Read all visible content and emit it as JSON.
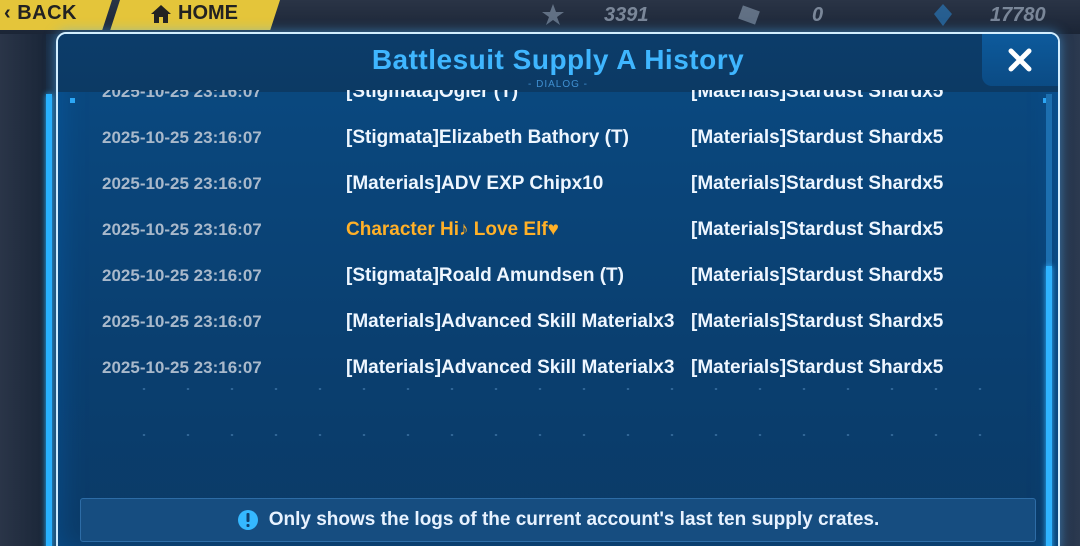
{
  "topbar": {
    "back_label": "BACK",
    "home_label": "HOME",
    "resource_1": "3391",
    "resource_2": "0",
    "resource_3": "17780"
  },
  "dialog": {
    "title": "Battlesuit Supply A History",
    "subtitle": "- DIALOG -",
    "close_icon": "close-icon"
  },
  "rows": [
    {
      "date": "2025-10-25 23:16:07",
      "item": "[Stigmata]Ogier (T)",
      "reward": "[Materials]Stardust Shardx5"
    },
    {
      "date": "2025-10-25 23:16:07",
      "item": "[Stigmata]Elizabeth Bathory (T)",
      "reward": "[Materials]Stardust Shardx5"
    },
    {
      "date": "2025-10-25 23:16:07",
      "item": "[Materials]ADV EXP Chipx10",
      "reward": "[Materials]Stardust Shardx5"
    },
    {
      "date": "2025-10-25 23:16:07",
      "item": "Character Hi♪ Love Elf♥",
      "reward": "[Materials]Stardust Shardx5",
      "highlight": true
    },
    {
      "date": "2025-10-25 23:16:07",
      "item": "[Stigmata]Roald Amundsen (T)",
      "reward": "[Materials]Stardust Shardx5"
    },
    {
      "date": "2025-10-25 23:16:07",
      "item": "[Materials]Advanced Skill Materialx3",
      "reward": "[Materials]Stardust Shardx5"
    },
    {
      "date": "2025-10-25 23:16:07",
      "item": "[Materials]Advanced Skill Materialx3",
      "reward": "[Materials]Stardust Shardx5"
    }
  ],
  "notice": {
    "icon": "info-icon",
    "text": "Only shows the logs of the current account's last ten supply crates."
  },
  "colors": {
    "accent": "#3fb6ff",
    "highlight": "#ffb028",
    "dialog_bg": "#0a4a82"
  }
}
